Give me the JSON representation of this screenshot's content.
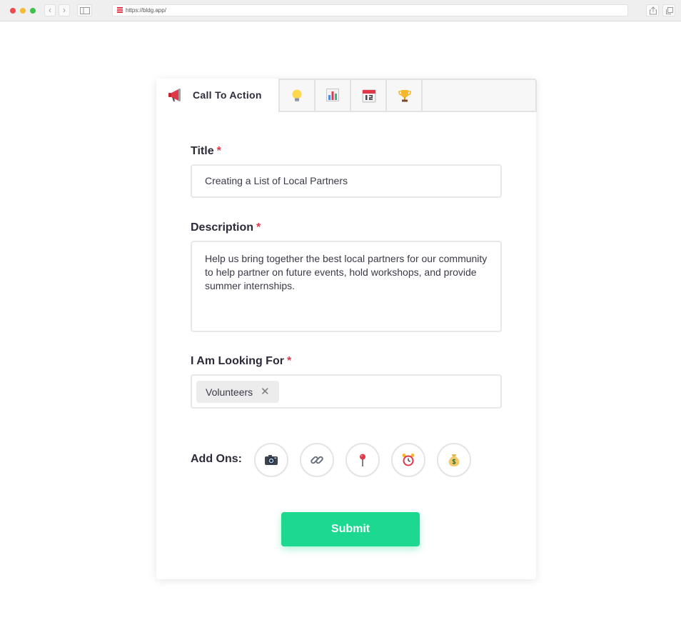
{
  "browser": {
    "url": "https://bldg.app/",
    "back_glyph": "‹",
    "forward_glyph": "›"
  },
  "tabs": {
    "active_label": "Call To Action",
    "active_icon": "megaphone-icon",
    "other_icons": [
      "lightbulb-icon",
      "bar-chart-icon",
      "calendar-icon",
      "trophy-icon"
    ]
  },
  "form": {
    "title_label": "Title",
    "title_required": "*",
    "title_value": "Creating a List of Local Partners",
    "description_label": "Description",
    "description_required": "*",
    "description_value": "Help us bring together the best local partners for our community to help partner on future events, hold workshops, and provide summer internships.",
    "looking_for_label": "I Am Looking For",
    "looking_for_required": "*",
    "looking_for_tags": [
      "Volunteers"
    ],
    "tag_remove_glyph": "✕",
    "addons_label": "Add Ons:",
    "addons": [
      "camera-icon",
      "link-icon",
      "pin-icon",
      "alarm-clock-icon",
      "money-bag-icon"
    ],
    "submit_label": "Submit"
  },
  "colors": {
    "accent": "#1dd88f",
    "required": "#e0394b"
  }
}
